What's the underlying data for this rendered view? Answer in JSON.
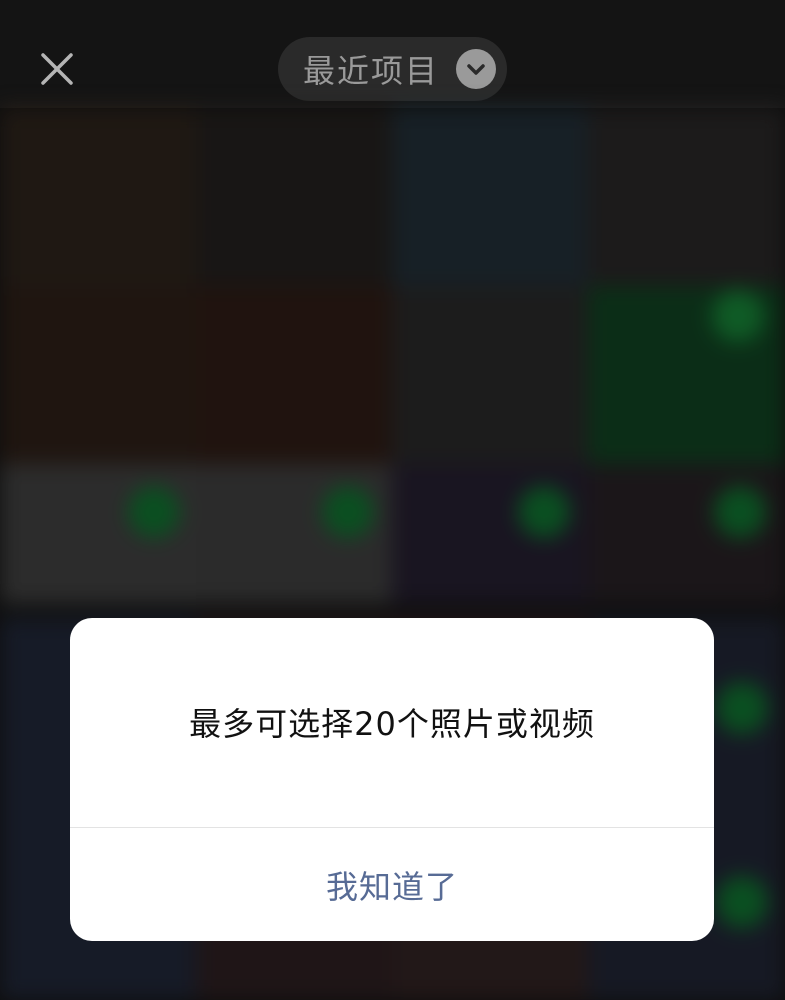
{
  "header": {
    "album_title": "最近项目",
    "close_icon": "close-icon",
    "dropdown_icon": "chevron-down-icon"
  },
  "dialog": {
    "message": "最多可选择20个照片或视频",
    "confirm_label": "我知道了"
  },
  "colors": {
    "background": "#131313",
    "dialog_button_text": "#576b95",
    "selected_badge": "#0e6a2c"
  }
}
